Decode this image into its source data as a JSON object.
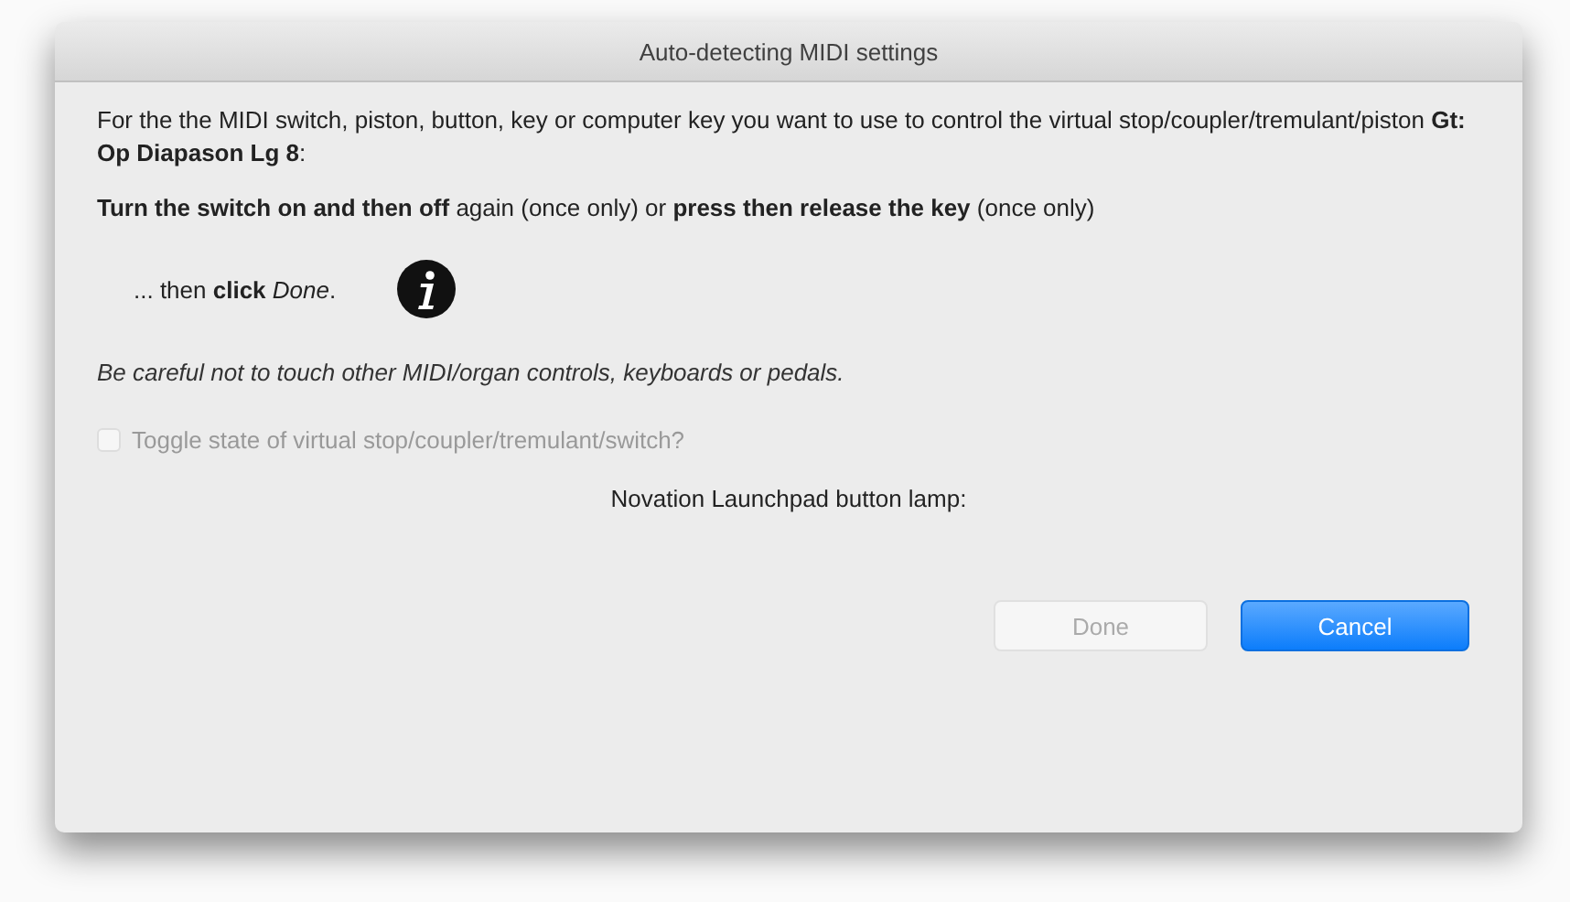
{
  "window": {
    "title": "Auto-detecting MIDI settings"
  },
  "intro": "For the the MIDI switch, piston, button, key or computer key you want to use to control the virtual stop/coupler/tremulant/piston **Gt: Op Diapason Lg 8**:",
  "instruction": "**Turn the switch on and then off** again (once only) or **press then release the key** (once only)",
  "then_text": "... then **click** *Done*.",
  "warning": "Be careful not to touch other MIDI/organ controls, keyboards or pedals.",
  "toggle": {
    "label": "Toggle state of virtual stop/coupler/tremulant/switch?",
    "checked": false,
    "disabled": true
  },
  "lamp_label": "Novation Launchpad button lamp:",
  "buttons": [
    {
      "label": "Done",
      "kind": "plain",
      "disabled": true
    },
    {
      "label": "Cancel",
      "kind": "default",
      "disabled": false
    }
  ]
}
